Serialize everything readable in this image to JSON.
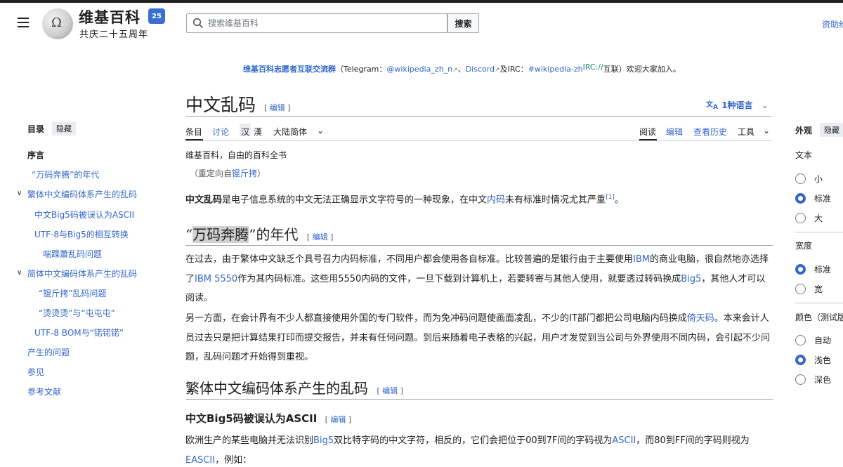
{
  "header": {
    "logo_title": "维基百科",
    "logo_subtitle": "共庆二十五周年",
    "logo_badge": "25",
    "search_placeholder": "搜索维基百科",
    "search_button": "搜索",
    "donate_label": "资助维"
  },
  "banner": {
    "prefix": "维基百科志愿者互联交流群",
    "open": "（Telegram：",
    "telegram": "@wikipedia_zh_n",
    "sep1": "、",
    "discord": "Discord",
    "sep2": "及IRC：",
    "irc_channel": "#wikipedia-zh",
    "irc_tag": "IRC://",
    "suffix": "互联）欢迎大家加入。"
  },
  "toc": {
    "title": "目录",
    "hide": "隐藏",
    "items": [
      {
        "label": "序言"
      },
      {
        "label": "“万码奔腾”的年代"
      },
      {
        "label": "繁体中文编码体系产生的乱码"
      },
      {
        "label": "中文Big5码被误认为ASCII"
      },
      {
        "label": "UTF-8与Big5的相互转换"
      },
      {
        "label": "喘蹀蕭乱码问题"
      },
      {
        "label": "简体中文编码体系产生的乱码"
      },
      {
        "label": "“锟斤拷”乱码问题"
      },
      {
        "label": "“烫烫烫”与“屯屯屯”"
      },
      {
        "label": "UTF-8 BOM与“锘锘锘”"
      },
      {
        "label": "产生的问题"
      },
      {
        "label": "参见"
      },
      {
        "label": "参考文献"
      }
    ]
  },
  "article": {
    "title": "中文乱码",
    "edit_open": "[ ",
    "edit_label": "编辑",
    "edit_close": " ]",
    "languages": "1种语言",
    "tabs": {
      "article": "条目",
      "talk": "讨论",
      "han_simp": "汉",
      "han_trad": "漢",
      "variant": "大陆简体",
      "read": "阅读",
      "edit": "编辑",
      "history": "查看历史",
      "tools": "工具"
    },
    "tagline": "维基百科，自由的百科全书",
    "redirect_prefix": "（重定向自",
    "redirect_link": "锟斤拷",
    "redirect_suffix": "）",
    "intro": {
      "bold": "中文乱码",
      "t1": "是电子信息系统的中文无法正确显示文字符号的一种现象，在中文",
      "link": "内码",
      "t2": "未有标准时情况尤其严重",
      "ref": "[1]",
      "t3": "。"
    },
    "h2_era": {
      "q1": "“",
      "hl": "万码奔腾",
      "q2": "”的年代"
    },
    "p1": {
      "t1": "在过去，由于繁体中文缺乏个具号召力内码标准，不同用户都会使用各自标准。比较普遍的是银行由于主要使用",
      "l1": "IBM",
      "t2": "的商业电脑，很自然地亦选择了",
      "l2": "IBM 5550",
      "t3": "作为其内码标准。这些用5550内码的文件，一旦下载到计算机上，若要转寄与其他人使用，就要透过转码换成",
      "l3": "Big5",
      "t4": "，其他人才可以阅读。"
    },
    "p2": {
      "t1": "另一方面，在会计界有不少人都直接使用外国的专门软件，而为免冲码问题使画面凌乱，不少的IT部门都把公司电脑内码换成",
      "l1": "倚天码",
      "t2": "。本来会计人员过去只是把计算结果打印而提交报告，并未有任何问题。到后来随着电子表格的兴起，用户才发觉到当公司与外界使用不同内码，会引起不少问题，乱码问题才开始得到重视。"
    },
    "h2_trad": "繁体中文编码体系产生的乱码",
    "h3_big5": "中文Big5码被误认为ASCII",
    "p3": {
      "t1": "欧洲生产的某些电脑并无法识别",
      "l1": "Big5",
      "t2": "双比特字码的中文字符，相反的，它们会把位于00到7F间的字码视为",
      "l2": "ASCII",
      "t3": "，而80到FF间的字码则视为",
      "l3": "EASCII",
      "t4": "，例如："
    }
  },
  "appearance": {
    "title": "外观",
    "hide": "隐藏",
    "text_label": "文本",
    "text_options": [
      "小",
      "标准",
      "大"
    ],
    "width_label": "宽度",
    "width_options": [
      "标准",
      "宽"
    ],
    "color_label": "颜色（测试版）",
    "color_options": [
      "自动",
      "浅色",
      "深色"
    ],
    "selected": {
      "text": "标准",
      "width": "标准",
      "color": "浅色"
    },
    "accent": "#3366cc"
  }
}
